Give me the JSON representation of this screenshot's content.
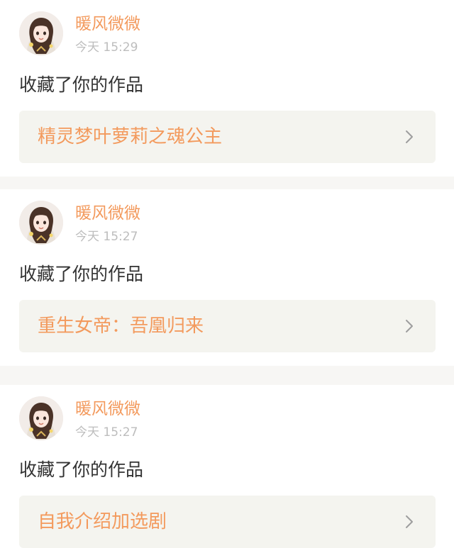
{
  "notifications": [
    {
      "username": "暖风微微",
      "timestamp": "今天 15:29",
      "action": "收藏了你的作品",
      "work_title": "精灵梦叶萝莉之魂公主"
    },
    {
      "username": "暖风微微",
      "timestamp": "今天 15:27",
      "action": "收藏了你的作品",
      "work_title": "重生女帝：吾凰归来"
    },
    {
      "username": "暖风微微",
      "timestamp": "今天 15:27",
      "action": "收藏了你的作品",
      "work_title": "自我介绍加选剧"
    }
  ],
  "icons": {
    "chevron": "chevron-right-icon",
    "avatar": "user-avatar"
  },
  "colors": {
    "accent": "#f39a5d",
    "muted_text": "#bdbdbd",
    "body_text": "#333333",
    "link_background": "#f4f4ef",
    "page_background": "#f7f6f4"
  }
}
